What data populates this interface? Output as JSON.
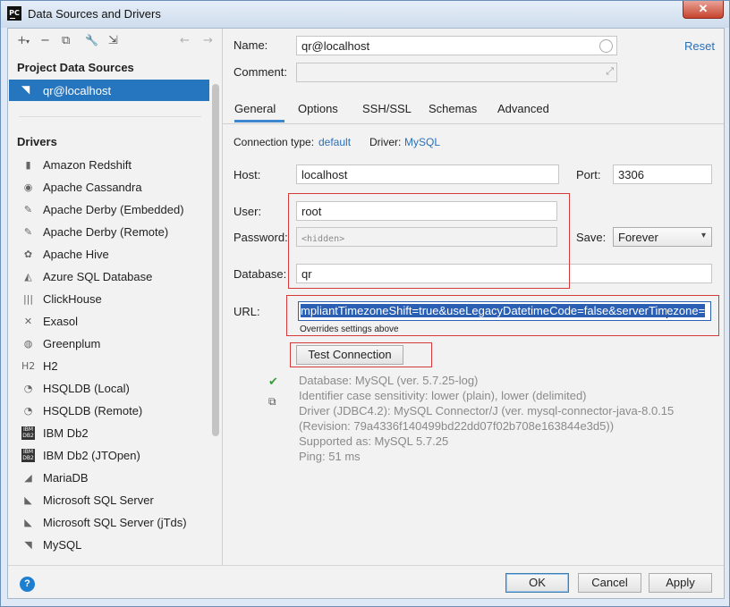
{
  "window": {
    "title": "Data Sources and Drivers",
    "app_icon_text": "PC",
    "close_glyph": "✕"
  },
  "toolbar": {
    "add": "+",
    "add_arrow": "▾",
    "remove": "−",
    "duplicate": "⧉",
    "settings": "🔧",
    "import": "⇲",
    "back": "←",
    "forward": "→"
  },
  "sidebar": {
    "project_title": "Project Data Sources",
    "project_items": [
      {
        "label": "qr@localhost",
        "icon": "mysql-dolphin-icon"
      }
    ],
    "drivers_title": "Drivers",
    "drivers": [
      {
        "label": "Amazon Redshift",
        "glyph": "▮"
      },
      {
        "label": "Apache Cassandra",
        "glyph": "◉"
      },
      {
        "label": "Apache Derby (Embedded)",
        "glyph": "✎"
      },
      {
        "label": "Apache Derby (Remote)",
        "glyph": "✎"
      },
      {
        "label": "Apache Hive",
        "glyph": "✿"
      },
      {
        "label": "Azure SQL Database",
        "glyph": "◭"
      },
      {
        "label": "ClickHouse",
        "glyph": "|||"
      },
      {
        "label": "Exasol",
        "glyph": "✕"
      },
      {
        "label": "Greenplum",
        "glyph": "◍"
      },
      {
        "label": "H2",
        "glyph": "H2"
      },
      {
        "label": "HSQLDB (Local)",
        "glyph": "◔"
      },
      {
        "label": "HSQLDB (Remote)",
        "glyph": "◔"
      },
      {
        "label": "IBM Db2",
        "glyph": "IBM DB2"
      },
      {
        "label": "IBM Db2 (JTOpen)",
        "glyph": "IBM DB2"
      },
      {
        "label": "MariaDB",
        "glyph": "◢"
      },
      {
        "label": "Microsoft SQL Server",
        "glyph": "◣"
      },
      {
        "label": "Microsoft SQL Server (jTds)",
        "glyph": "◣"
      },
      {
        "label": "MySQL",
        "glyph": "◥"
      }
    ]
  },
  "form": {
    "name_label": "Name:",
    "name_value": "qr@localhost",
    "comment_label": "Comment:",
    "comment_value": "",
    "reset_link": "Reset",
    "tabs": [
      "General",
      "Options",
      "SSH/SSL",
      "Schemas",
      "Advanced"
    ],
    "connection_type_label": "Connection type:",
    "connection_type_value": "default",
    "driver_label": "Driver:",
    "driver_value": "MySQL",
    "host_label": "Host:",
    "host_value": "localhost",
    "port_label": "Port:",
    "port_value": "3306",
    "user_label": "User:",
    "user_value": "root",
    "password_label": "Password:",
    "password_placeholder": "<hidden>",
    "save_label": "Save:",
    "save_value": "Forever",
    "database_label": "Database:",
    "database_value": "qr",
    "url_label": "URL:",
    "url_value_a": "mpliantTimezoneShift=true&useLegacyDatetimeCode=false&serverTim",
    "url_value_b": "ezone=",
    "url_note": "Overrides settings above",
    "test_connection": "Test Connection"
  },
  "status": {
    "lines": [
      "Database: MySQL (ver. 5.7.25-log)",
      "Identifier case sensitivity: lower (plain), lower (delimited)",
      "Driver (JDBC4.2): MySQL Connector/J (ver. mysql-connector-java-8.0.15",
      "(Revision: 79a4336f140499bd22dd07f02b708e163844e3d5))",
      "Supported as: MySQL 5.7.25",
      "Ping: 51 ms"
    ]
  },
  "buttons": {
    "help": "?",
    "ok": "OK",
    "cancel": "Cancel",
    "apply": "Apply"
  },
  "colors": {
    "accent": "#2675bf",
    "link": "#2a6fb7",
    "highlight_box": "#d53a3a",
    "success": "#3a9a3a"
  }
}
